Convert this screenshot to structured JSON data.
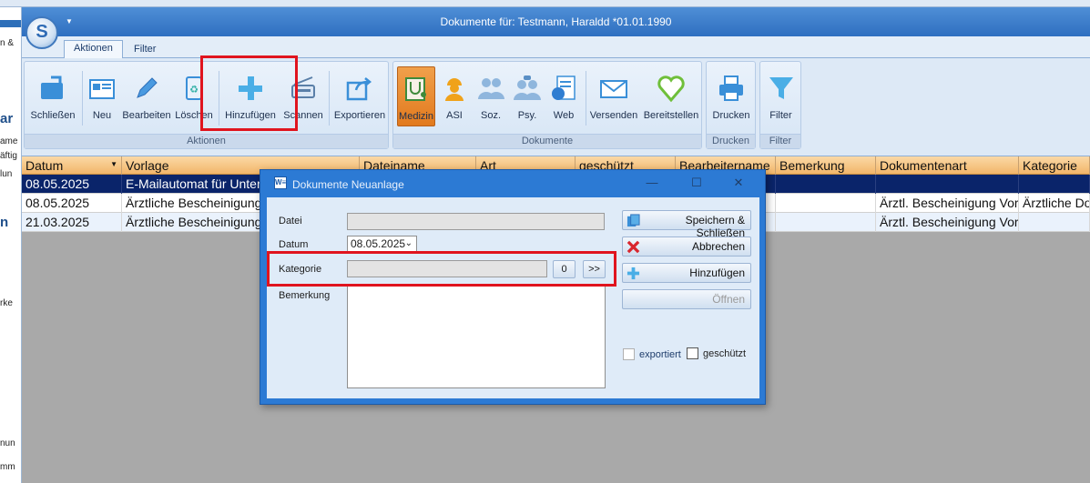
{
  "window": {
    "title": "Dokumente für: Testmann, Haraldd *01.01.1990",
    "app_button": "S"
  },
  "left_peek": {
    "line1": "ame",
    "line2": "äftig",
    "line3": "lun",
    "big1": "ar",
    "big2": "n",
    "line4": "rke",
    "line5": "nun",
    "line6": "mm",
    "line7": "n &"
  },
  "ribbon_tabs": [
    "Aktionen",
    "Filter"
  ],
  "groups": {
    "aktionen": {
      "caption": "Aktionen",
      "buttons": [
        "Schließen",
        "Neu",
        "Bearbeiten",
        "Löschen",
        "Hinzufügen",
        "Scannen",
        "Exportieren"
      ]
    },
    "dokumente": {
      "caption": "Dokumente",
      "buttons": [
        "Medizin",
        "ASI",
        "Soz.",
        "Psy.",
        "Web",
        "Versenden",
        "Bereitstellen"
      ]
    },
    "drucken": {
      "caption": "Drucken",
      "buttons": [
        "Drucken"
      ]
    },
    "filter": {
      "caption": "Filter",
      "buttons": [
        "Filter"
      ]
    }
  },
  "grid": {
    "columns": [
      "Datum",
      "Vorlage",
      "Dateiname",
      "Art",
      "geschützt",
      "Bearbeitername",
      "Bemerkung",
      "Dokumentenart",
      "Kategorie"
    ],
    "rows": [
      [
        "08.05.2025",
        "E-Mailautomat für Unter",
        "",
        "",
        "",
        "",
        "",
        "",
        ""
      ],
      [
        "08.05.2025",
        "Ärztliche Bescheinigung",
        "",
        "",
        "",
        "",
        "",
        "Ärztl. Bescheinigung Vor",
        "Ärztliche Do"
      ],
      [
        "21.03.2025",
        "Ärztliche Bescheinigung",
        "",
        "",
        "",
        "",
        "",
        "Ärztl. Bescheinigung Vor",
        ""
      ]
    ]
  },
  "dialog": {
    "title": "Dokumente Neuanlage",
    "icon": "W≡",
    "labels": {
      "datei": "Datei",
      "datum": "Datum",
      "kategorie": "Kategorie",
      "bemerkung": "Bemerkung"
    },
    "datum_value": "08.05.2025",
    "kategorie_count": "0",
    "kategorie_more": ">>",
    "buttons": {
      "save": "Speichern & Schließen",
      "cancel": "Abbrechen",
      "add": "Hinzufügen",
      "open": "Öffnen"
    },
    "checkboxes": {
      "exportiert": "exportiert",
      "geschuetzt": "geschützt"
    },
    "controls": {
      "minimize": "—",
      "maximize": "☐",
      "close": "✕"
    }
  },
  "accent_colors": {
    "title_blue": "#2e6fc0",
    "grid_header": "#f2b66a",
    "selection": "#0a246a",
    "highlight_red": "#e0141e",
    "selected_ribbon": "#e27a1e"
  }
}
